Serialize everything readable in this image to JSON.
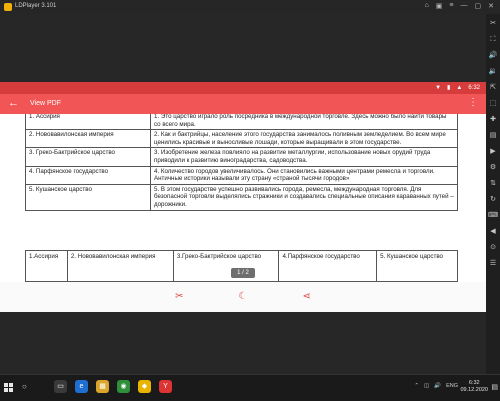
{
  "emulator": {
    "title": "LDPlayer 3.101",
    "window_controls": [
      "⌂",
      "▣",
      "≡",
      "—",
      "▢",
      "✕"
    ],
    "sidebar_icons": [
      "✂",
      "⛶",
      "🔊",
      "🔉",
      "⇱",
      "⬚",
      "✚",
      "▤",
      "▶",
      "⚙",
      "⇅",
      "↻",
      "⌨",
      "◀",
      "⊙",
      "☰"
    ]
  },
  "android": {
    "status_icons": [
      "▼",
      "▮",
      "▲"
    ],
    "time": "6:32",
    "app_title": "View PDF",
    "page_indicator": "1 / 2"
  },
  "table1": [
    {
      "name": "1. Ассирия",
      "desc": "1.  Это царство играло роль посредника в международной торговле. Здесь можно было найти товары со всего мира."
    },
    {
      "name": "2. Нововавилонская империя",
      "desc": "2. Как и бактрийцы, население этого государства занималось поливным земледелием. Во всем мире ценились красивые и выносливые лошади, которые выращивали в этом государстве."
    },
    {
      "name": "3. Греко-Бактрийское царство",
      "desc": "3. Изобретение железа повлияло на развитие металлургии, использование новых орудий труда приводили к развитию виноградарства, садоводства."
    },
    {
      "name": "4. Парфянское государство",
      "desc": "4. Количество городов увеличивалось. Они становились важными центрами ремесла и торговли. Античные историки называли эту страну «страной тысячи городов»"
    },
    {
      "name": "5. Кушанское царство",
      "desc": "5. В этом государстве успешно развивались города, ремесла, международная торговля. Для безопасной торговли выделялись стражники и создавались специальные описания караванных путей – дорожники."
    }
  ],
  "table2": [
    "1.Ассирия",
    "2. Нововавилонская империя",
    "3.Греко-Бактрийское царство",
    "4.Парфянское государство",
    "5. Кушанское царство"
  ],
  "bottom_actions": [
    "✂",
    "☾",
    "⋖"
  ],
  "taskbar": {
    "search": "○",
    "apps": [
      "▭",
      "e",
      "▦",
      "◉",
      "◆",
      "Y"
    ],
    "tray": [
      "⌃",
      "◫",
      "🔊",
      "ENG"
    ],
    "time": "6:32",
    "date": "09.12.2020",
    "notification": "▤"
  }
}
